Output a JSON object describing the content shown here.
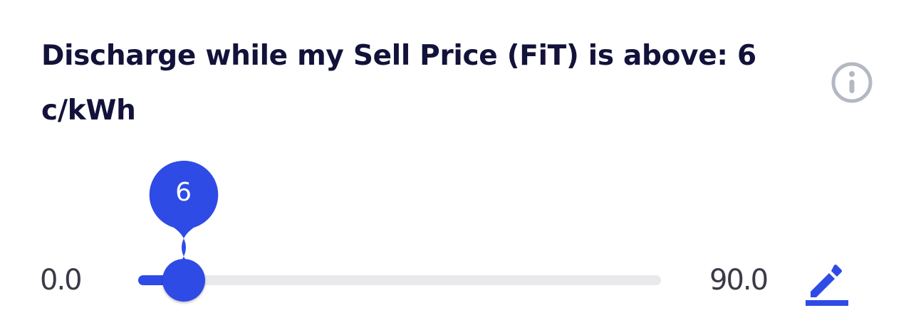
{
  "setting": {
    "title": "Discharge while my Sell Price (FiT) is above: 6 c/kWh"
  },
  "slider": {
    "min_label": "0.0",
    "max_label": "90.0",
    "min": 0,
    "max": 90,
    "value": 6,
    "value_label": "6"
  },
  "icons": {
    "info": "info-circle-icon",
    "edit": "pencil-edit-icon"
  },
  "colors": {
    "accent": "#2e4be6",
    "title_text": "#12123a",
    "track": "#e9e9ec",
    "info_icon": "#b4b8c2"
  }
}
